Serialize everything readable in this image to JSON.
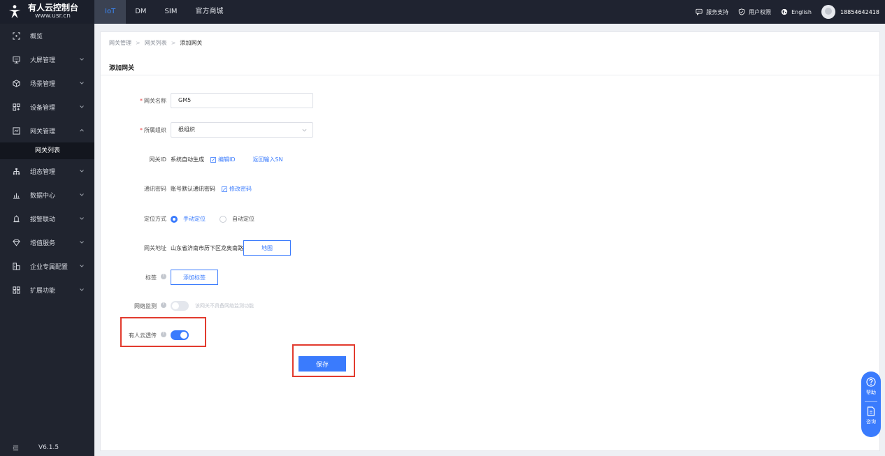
{
  "brand": {
    "title": "有人云控制台",
    "subtitle": "www.usr.cn"
  },
  "topnav": [
    {
      "label": "IoT",
      "active": true
    },
    {
      "label": "DM"
    },
    {
      "label": "SIM"
    },
    {
      "label": "官方商城"
    }
  ],
  "top_right": {
    "support": "服务支持",
    "permissions": "用户权限",
    "language": "English",
    "user": "18854642418"
  },
  "sidebar": {
    "items": [
      {
        "label": "概览",
        "icon": "overview-icon"
      },
      {
        "label": "大屏管理",
        "icon": "screen-icon"
      },
      {
        "label": "场景管理",
        "icon": "scene-icon"
      },
      {
        "label": "设备管理",
        "icon": "device-icon"
      },
      {
        "label": "网关管理",
        "icon": "gateway-icon",
        "expanded": true
      },
      {
        "label": "组态管理",
        "icon": "config-icon"
      },
      {
        "label": "数据中心",
        "icon": "data-icon"
      },
      {
        "label": "报警联动",
        "icon": "alarm-icon"
      },
      {
        "label": "增值服务",
        "icon": "diamond-icon"
      },
      {
        "label": "企业专属配置",
        "icon": "enterprise-icon"
      },
      {
        "label": "扩展功能",
        "icon": "apps-icon"
      }
    ],
    "sub_active": "网关列表",
    "version": "V6.1.5"
  },
  "breadcrumb": [
    "网关管理",
    "网关列表",
    "添加网关"
  ],
  "page_title": "添加网关",
  "form": {
    "name_label": "网关名称",
    "name_value": "GM5",
    "org_label": "所属组织",
    "org_value": "根组织",
    "id_label": "网关ID",
    "id_value": "系统自动生成",
    "id_edit": "编辑ID",
    "id_back": "返回输入SN",
    "pwd_label": "通讯密码",
    "pwd_value": "账号默认通讯密码",
    "pwd_edit": "修改密码",
    "loc_label": "定位方式",
    "loc_manual": "手动定位",
    "loc_auto": "自动定位",
    "addr_label": "网关地址",
    "addr_value": "山东省济南市历下区龙奥南路",
    "addr_map": "地图",
    "tag_label": "标签",
    "tag_add": "添加标签",
    "net_label": "网络监测",
    "net_hint": "该网关不具备网络监测功能",
    "relay_label": "有人云透传",
    "relay_on": true,
    "save": "保存"
  },
  "float_help": {
    "help": "帮助",
    "consult": "咨询"
  },
  "colors": {
    "accent": "#3a7bfd",
    "highlight": "#e23b2e",
    "sidebar": "#20242f",
    "topbar": "#1f2330"
  }
}
